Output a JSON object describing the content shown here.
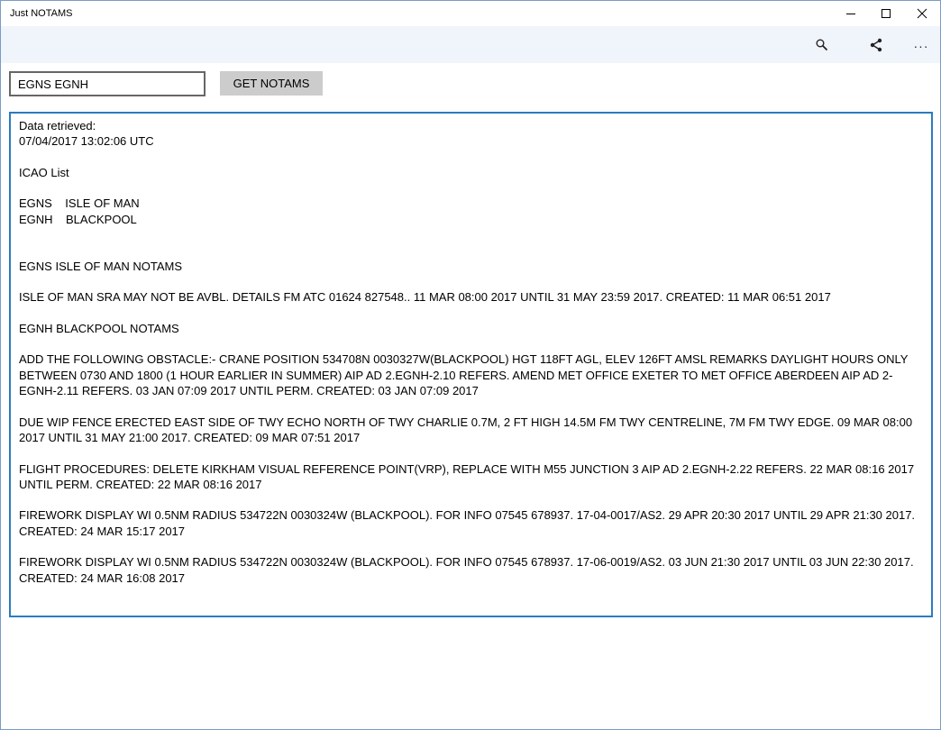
{
  "window": {
    "title": "Just NOTAMS"
  },
  "titlebar_buttons": {
    "minimize_icon": "minimize-icon",
    "maximize_icon": "maximize-icon",
    "close_icon": "close-icon"
  },
  "commandbar": {
    "search_icon": "search-icon",
    "share_icon": "share-icon",
    "more_icon": "more-icon",
    "more_glyph": "···"
  },
  "query": {
    "icao_value": "EGNS EGNH",
    "button_label": "GET NOTAMS"
  },
  "output": {
    "retrieved_label": "Data retrieved:",
    "retrieved_time": "07/04/2017 13:02:06 UTC",
    "icao_list_title": "ICAO List",
    "icao_list": [
      {
        "code": "EGNS",
        "name": "ISLE OF MAN"
      },
      {
        "code": "EGNH",
        "name": "BLACKPOOL"
      }
    ],
    "sections": [
      {
        "heading": "EGNS ISLE OF MAN NOTAMS",
        "notams": [
          "ISLE OF MAN SRA MAY NOT BE AVBL. DETAILS FM ATC 01624 827548.. 11 MAR 08:00 2017 UNTIL 31 MAY 23:59 2017. CREATED: 11 MAR 06:51 2017"
        ]
      },
      {
        "heading": "EGNH BLACKPOOL NOTAMS",
        "notams": [
          "ADD THE FOLLOWING OBSTACLE:- CRANE POSITION 534708N 0030327W(BLACKPOOL) HGT 118FT AGL, ELEV 126FT AMSL REMARKS DAYLIGHT HOURS ONLY BETWEEN 0730 AND 1800 (1 HOUR EARLIER IN SUMMER) AIP AD 2.EGNH-2.10 REFERS. AMEND MET OFFICE EXETER TO MET OFFICE ABERDEEN AIP AD 2-EGNH-2.11 REFERS. 03 JAN 07:09 2017 UNTIL PERM. CREATED: 03 JAN 07:09 2017",
          "DUE WIP FENCE ERECTED EAST SIDE OF TWY ECHO NORTH OF TWY CHARLIE 0.7M, 2 FT HIGH 14.5M FM TWY CENTRELINE, 7M FM TWY EDGE. 09 MAR 08:00 2017 UNTIL 31 MAY 21:00 2017. CREATED: 09 MAR 07:51 2017",
          "FLIGHT PROCEDURES: DELETE KIRKHAM VISUAL REFERENCE POINT(VRP), REPLACE WITH M55 JUNCTION 3 AIP AD 2.EGNH-2.22 REFERS. 22 MAR 08:16 2017 UNTIL PERM. CREATED: 22 MAR 08:16 2017",
          "FIREWORK DISPLAY WI 0.5NM RADIUS 534722N 0030324W (BLACKPOOL). FOR INFO 07545 678937. 17-04-0017/AS2. 29 APR 20:30 2017 UNTIL 29 APR 21:30 2017. CREATED: 24 MAR 15:17 2017",
          "FIREWORK DISPLAY WI 0.5NM RADIUS 534722N 0030324W (BLACKPOOL). FOR INFO 07545 678937. 17-06-0019/AS2. 03 JUN 21:30 2017 UNTIL 03 JUN 22:30 2017. CREATED: 24 MAR 16:08 2017"
        ]
      }
    ]
  },
  "colors": {
    "commandbar_bg": "#f0f4fb",
    "output_border": "#2c7bbf",
    "button_bg": "#cccccc"
  }
}
